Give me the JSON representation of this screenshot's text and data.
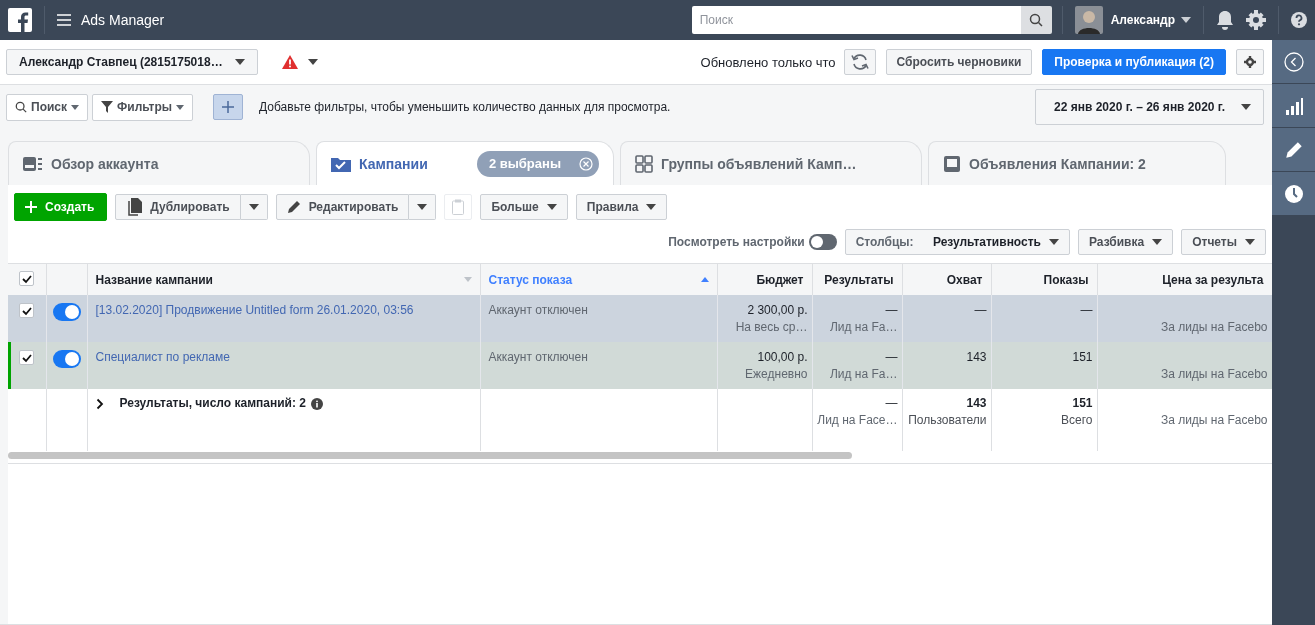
{
  "topbar": {
    "app_title": "Ads Manager",
    "search_placeholder": "Поиск",
    "user_name": "Александр"
  },
  "account_bar": {
    "account": "Александр Ставпец (2815175018…",
    "updated": "Обновлено только что",
    "reset_button": "Сбросить черновики",
    "publish_button": "Проверка и публикация (2)"
  },
  "filter_bar": {
    "search": "Поиск",
    "filters": "Фильтры",
    "hint": "Добавьте фильтры, чтобы уменьшить количество данных для просмотра.",
    "date_range": "22 янв 2020 г. – 26 янв 2020 г."
  },
  "tabs": [
    {
      "kind": "overview",
      "label": "Обзор аккаунта",
      "selected": false
    },
    {
      "kind": "campaigns",
      "label": "Кампании",
      "selected": true,
      "badge": "2 выбраны"
    },
    {
      "kind": "adsets",
      "label": "Группы объявлений Камп…",
      "selected": false
    },
    {
      "kind": "ads",
      "label": "Объявления Кампании: 2",
      "selected": false
    }
  ],
  "toolbar": {
    "create": "Создать",
    "duplicate": "Дублировать",
    "edit": "Редактировать",
    "more": "Больше",
    "rules": "Правила"
  },
  "view_settings": {
    "label": "Посмотреть настройки",
    "on": false
  },
  "columns_button": {
    "prefix": "Столбцы:",
    "value": "Результативность"
  },
  "breakdown": "Разбивка",
  "reports": "Отчеты",
  "table": {
    "all_checked": true,
    "columns": [
      {
        "kind": "name",
        "label": "Название кампании",
        "sorted": false
      },
      {
        "kind": "text",
        "label": "Статус показа",
        "sorted": true
      },
      {
        "kind": "number",
        "label": "Бюджет",
        "sorted": false
      },
      {
        "kind": "number",
        "label": "Результаты",
        "sorted": false
      },
      {
        "kind": "number",
        "label": "Охват",
        "sorted": false
      },
      {
        "kind": "number",
        "label": "Показы",
        "sorted": false
      },
      {
        "kind": "number",
        "label": "Цена за результа",
        "sorted": false
      }
    ],
    "rows": [
      {
        "checked": true,
        "on": true,
        "marked": false,
        "name": "[13.02.2020] Продвижение Untitled form 26.01.2020, 03:56",
        "status": "Аккаунт отключен",
        "budget": "2 300,00 р.",
        "budget_type": "На весь ср…",
        "results": "—",
        "results_type": "Лид на Fa…",
        "reach": "—",
        "impressions": "—",
        "cost_type": "За лиды на Facebo"
      },
      {
        "checked": true,
        "on": true,
        "marked": true,
        "name": "Специалист по рекламе",
        "status": "Аккаунт отключен",
        "budget": "100,00 р.",
        "budget_type": "Ежедневно",
        "results": "—",
        "results_type": "Лид на Fa…",
        "reach": "143",
        "impressions": "151",
        "cost_type": "За лиды на Facebo"
      }
    ],
    "summary": {
      "label": "Результаты, число кампаний: 2",
      "results": "—",
      "results_type": "Лид на Face…",
      "reach": "143",
      "reach_type": "Пользователи",
      "impressions": "151",
      "impressions_type": "Всего",
      "cost_type": "За лиды на Facebo"
    }
  }
}
